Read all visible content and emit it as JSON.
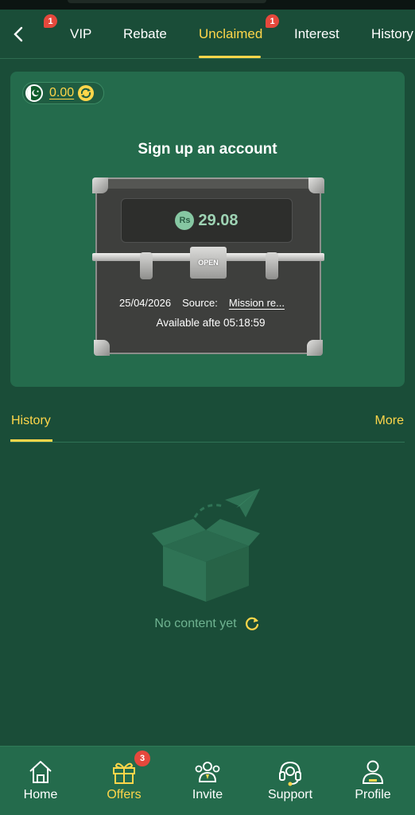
{
  "nav": {
    "back_icon": "chevron-left-icon",
    "tabs": [
      {
        "label": "VIP",
        "badge": "1"
      },
      {
        "label": "Rebate"
      },
      {
        "label": "Unclaimed",
        "badge": "1",
        "active": true
      },
      {
        "label": "Interest"
      },
      {
        "label": "History"
      }
    ]
  },
  "card": {
    "balance": "0.00",
    "title": "Sign up an account",
    "chest": {
      "currency_badge": "Rs",
      "amount": "29.08",
      "lock_label": "OPEN",
      "date": "25/04/2026",
      "source_label": "Source:",
      "source_value": "Mission re...",
      "available_text": "Available afte 05:18:59"
    }
  },
  "history": {
    "title": "History",
    "more": "More",
    "empty_text": "No content yet"
  },
  "bottom_nav": [
    {
      "label": "Home",
      "icon": "home-icon"
    },
    {
      "label": "Offers",
      "icon": "gift-icon",
      "badge": "3",
      "active": true
    },
    {
      "label": "Invite",
      "icon": "invite-icon"
    },
    {
      "label": "Support",
      "icon": "headset-icon"
    },
    {
      "label": "Profile",
      "icon": "profile-icon"
    }
  ],
  "colors": {
    "background": "#1a4d38",
    "card": "#246b4c",
    "accent": "#ffd64a",
    "badge": "#e5483c"
  }
}
